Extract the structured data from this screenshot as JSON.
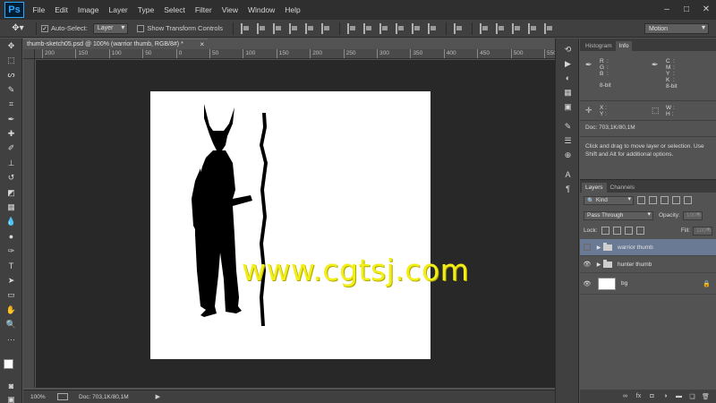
{
  "app": {
    "logo": "Ps"
  },
  "menu": [
    "File",
    "Edit",
    "Image",
    "Layer",
    "Type",
    "Select",
    "Filter",
    "View",
    "Window",
    "Help"
  ],
  "window_controls": {
    "minimize": "–",
    "maximize": "□",
    "close": "✕"
  },
  "options": {
    "auto_select_label": "Auto-Select:",
    "auto_select_value": "Layer",
    "show_transform_label": "Show Transform Controls",
    "workspace": "Motion"
  },
  "document": {
    "tab_title": "thumb-sketch05.psd @ 100% (warrior thumb, RGB/8#) *",
    "tab_close": "×",
    "zoom": "100%",
    "doc_size": "Doc: 703,1K/80,1M",
    "ruler_ticks": [
      "200",
      "150",
      "100",
      "50",
      "0",
      "50",
      "100",
      "150",
      "200",
      "250",
      "300",
      "350",
      "400",
      "450",
      "500",
      "550"
    ]
  },
  "watermark": "www.cgtsj.com",
  "info_panel": {
    "tabs": [
      "Histogram",
      "Info"
    ],
    "left_channels": [
      [
        "R",
        ":"
      ],
      [
        "G",
        ":"
      ],
      [
        "B",
        ":"
      ]
    ],
    "left_bits": "8-bit",
    "right_channels": [
      [
        "C",
        ":"
      ],
      [
        "M",
        ":"
      ],
      [
        "Y",
        ":"
      ],
      [
        "K",
        ":"
      ]
    ],
    "right_bits": "8-bit",
    "x_label": "X :",
    "y_label": "Y :",
    "w_label": "W :",
    "h_label": "H :",
    "doc": "Doc: 703,1K/80,1M",
    "hint": "Click and drag to move layer or selection.  Use Shift and Alt for additional options."
  },
  "layers_panel": {
    "tabs": [
      "Layers",
      "Channels"
    ],
    "kind": "Kind",
    "blend_mode": "Pass Through",
    "opacity_label": "Opacity:",
    "opacity_value": "100%",
    "lock_label": "Lock:",
    "fill_label": "Fill:",
    "fill_value": "100%",
    "layers": [
      {
        "name": "warrior thumb",
        "type": "group",
        "visible": false,
        "selected": true
      },
      {
        "name": "hunter thumb",
        "type": "group",
        "visible": true,
        "selected": false
      },
      {
        "name": "bg",
        "type": "pixel",
        "visible": true,
        "selected": false,
        "locked": true
      }
    ]
  },
  "colors": {
    "foreground": "#ffffff",
    "background": "#2e7fd8",
    "selected_layer": "#6a7a95",
    "watermark": "#f2ee1a"
  }
}
